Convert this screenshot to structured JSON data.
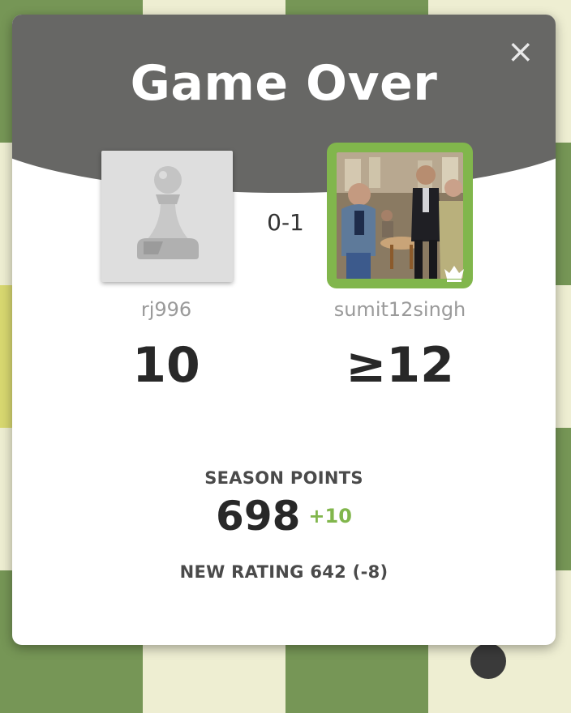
{
  "dialog": {
    "title": "Game Over",
    "close_label": "×",
    "result": "0-1"
  },
  "players": {
    "left": {
      "username": "rj996",
      "points": "10",
      "avatar": "pawn-icon"
    },
    "right": {
      "username": "sumit12singh",
      "points": "≥12",
      "avatar": "player-photo",
      "badge": "crown-icon"
    }
  },
  "season": {
    "label": "SEASON POINTS",
    "value": "698",
    "change": "+10"
  },
  "rating": {
    "text": "NEW RATING 642 (-8)"
  },
  "colors": {
    "header": "#676765",
    "accent_green": "#81b64c",
    "board_light": "#eeeed2",
    "board_dark": "#769656"
  }
}
